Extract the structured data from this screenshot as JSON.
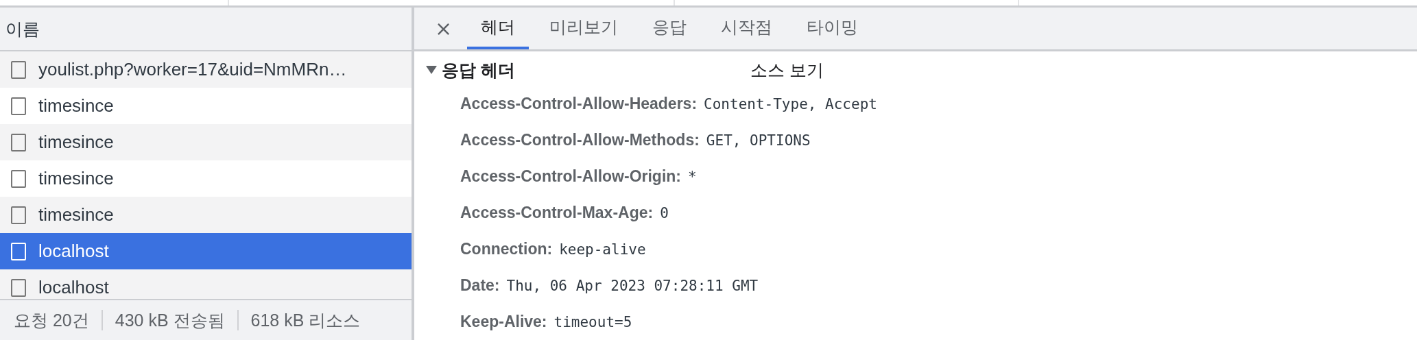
{
  "request_list": {
    "header": "이름",
    "rows": [
      {
        "name": "youlist.php?worker=17&uid=NmMRn…",
        "selected": false
      },
      {
        "name": "timesince",
        "selected": false
      },
      {
        "name": "timesince",
        "selected": false
      },
      {
        "name": "timesince",
        "selected": false
      },
      {
        "name": "timesince",
        "selected": false
      },
      {
        "name": "localhost",
        "selected": true
      },
      {
        "name": "localhost",
        "selected": false
      }
    ],
    "status_bar": [
      "요청 20건",
      "430 kB 전송됨",
      "618 kB 리소스"
    ]
  },
  "detail": {
    "close": "×",
    "tabs": [
      {
        "label": "헤더",
        "selected": true
      },
      {
        "label": "미리보기",
        "selected": false
      },
      {
        "label": "응답",
        "selected": false
      },
      {
        "label": "시작점",
        "selected": false
      },
      {
        "label": "타이밍",
        "selected": false
      }
    ],
    "section": {
      "title": "응답 헤더",
      "expanded": true,
      "view_source": "소스 보기",
      "headers": [
        {
          "name": "Access-Control-Allow-Headers:",
          "value": "Content-Type, Accept"
        },
        {
          "name": "Access-Control-Allow-Methods:",
          "value": "GET, OPTIONS"
        },
        {
          "name": "Access-Control-Allow-Origin:",
          "value": "*"
        },
        {
          "name": "Access-Control-Max-Age:",
          "value": "0"
        },
        {
          "name": "Connection:",
          "value": "keep-alive"
        },
        {
          "name": "Date:",
          "value": "Thu, 06 Apr 2023 07:28:11 GMT"
        },
        {
          "name": "Keep-Alive:",
          "value": "timeout=5"
        }
      ]
    }
  }
}
